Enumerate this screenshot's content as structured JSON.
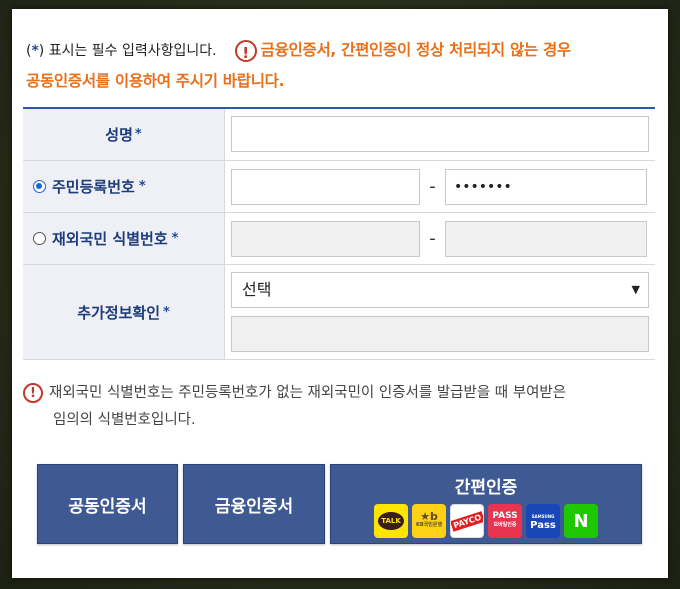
{
  "notice": {
    "required_prefix": "(",
    "required_star": "*",
    "required_suffix": ") 표시는 필수 입력사항입니다.",
    "warn_glyph": "!",
    "warning_line1": "금융인증서, 간편인증이 정상 처리되지 않는 경우",
    "warning_line2": "공동인증서를 이용하여 주시기 바랍니다."
  },
  "form": {
    "name_label": "성명",
    "star": "*",
    "rrn_label": "주민등록번호",
    "rrn_second_value": "•••••••",
    "foreign_label": "재외국민 식별번호",
    "dash": "-",
    "extra_label": "추가정보확인",
    "extra_select_value": "선택",
    "caret": "▼"
  },
  "info": {
    "warn_glyph": "!",
    "line1": "재외국민 식별번호는 주민등록번호가 없는 재외국민이 인증서를 발급받을 때 부여받은",
    "line2": "임의의 식별번호입니다."
  },
  "buttons": {
    "joint_cert": "공동인증서",
    "finance_cert": "금융인증서",
    "simple_auth": "간편인증"
  },
  "logos": {
    "kakao": "TALK",
    "kb_top": "★b",
    "kb_bottom": "KB국민은행",
    "payco": "PAYCO",
    "pass": "PASS",
    "pass_sub": "모바일인증",
    "samsung_top": "SAMSUNG",
    "samsung_bottom": "Pass",
    "naver": "N"
  },
  "colors": {
    "accent_blue": "#2b5aa5",
    "button_blue": "#3f5a93",
    "warning_orange": "#e8701a",
    "warning_red": "#c0392b"
  }
}
